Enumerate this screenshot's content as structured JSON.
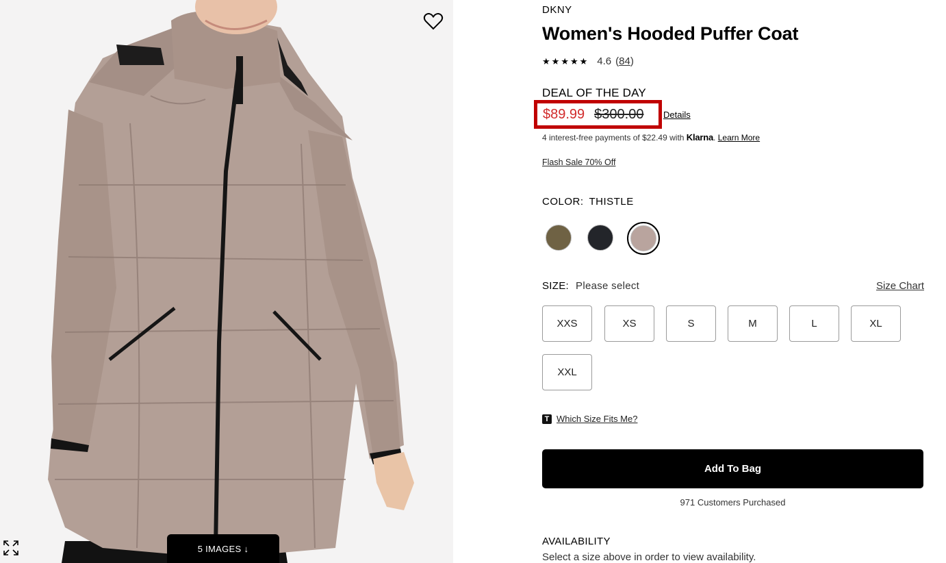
{
  "gallery": {
    "images_button_label": "5 IMAGES",
    "images_button_arrow": "↓",
    "icons": {
      "wishlist": "heart-icon",
      "expand": "expand-icon"
    }
  },
  "product": {
    "brand": "DKNY",
    "title": "Women's Hooded Puffer Coat",
    "rating": {
      "stars": 4.6,
      "value_text": "4.6",
      "open_paren": "(",
      "count": "84",
      "close_paren": ")"
    },
    "deal_label": "DEAL OF THE DAY",
    "sale_price": "$89.99",
    "original_price": "$300.00",
    "details_label": "Details",
    "klarna": {
      "prefix": "4 interest-free payments of $22.49 with ",
      "brand": "Klarna",
      "dot": ".",
      "learn_more": "Learn More"
    },
    "flash_sale": "Flash Sale 70% Off",
    "color": {
      "label": "COLOR:",
      "selected": "THISTLE",
      "swatches": [
        {
          "name": "olive",
          "hex": "#6f6244"
        },
        {
          "name": "black",
          "hex": "#23252a"
        },
        {
          "name": "thistle",
          "hex": "#b9a49e"
        }
      ]
    },
    "size": {
      "label": "SIZE:",
      "prompt": "Please select",
      "chart_link": "Size Chart",
      "options": [
        "XXS",
        "XS",
        "S",
        "M",
        "L",
        "XL",
        "XXL"
      ]
    },
    "fit_icon": "T",
    "fit_link": "Which Size Fits Me?",
    "add_to_bag": "Add To Bag",
    "purchased": "971 Customers Purchased",
    "availability_label": "AVAILABILITY",
    "availability_note": "Select a size above in order to view availability."
  },
  "colors": {
    "sale_red": "#d12a2a",
    "highlight_border": "#c00000"
  }
}
